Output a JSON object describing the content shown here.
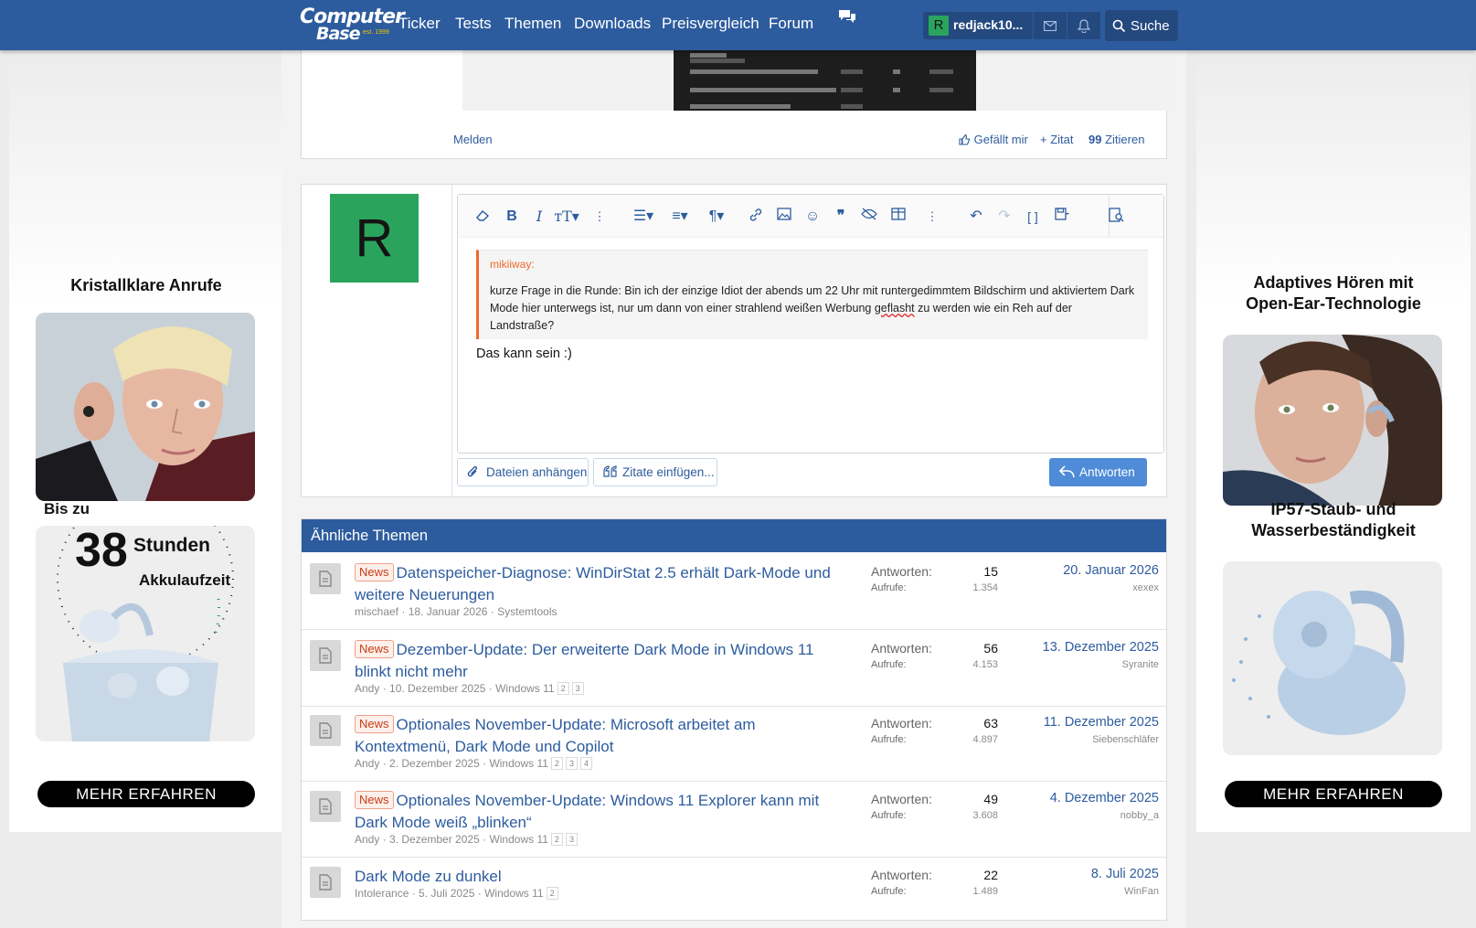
{
  "brand": {
    "line1": "Computer",
    "line2": "Base",
    "est": "est. 1999"
  },
  "nav": [
    "Ticker",
    "Tests",
    "Themen",
    "Downloads",
    "Preisvergleich",
    "Forum"
  ],
  "user": {
    "initial": "R",
    "name": "redjack10...",
    "avatar_color": "#2aa45d"
  },
  "search_label": "Suche",
  "colors": {
    "brand_blue": "#2d5c9e",
    "accent_orange": "#f06a2a",
    "primary_button": "#4f8bd7"
  },
  "ad_left": {
    "title": "Kristallklare Anrufe",
    "promo_prefix": "Bis zu",
    "promo_number": "38",
    "promo_unit": "Stunden",
    "promo_suffix": "Akkulaufzeit",
    "button": "MEHR ERFAHREN"
  },
  "ad_right": {
    "title_line1": "Adaptives Hören mit",
    "title_line2": "Open-Ear-Technologie",
    "subtitle_line1": "IP57-Staub- und",
    "subtitle_line2": "Wasserbeständigkeit",
    "button": "MEHR ERFAHREN"
  },
  "previous_post": {
    "report": "Melden",
    "like": "Gefällt mir",
    "quote_plus": "+ Zitat",
    "quote": "Zitieren"
  },
  "reply": {
    "avatar_initial": "R",
    "toolbar_icons": [
      "eraser-icon",
      "bold-icon",
      "italic-icon",
      "font-size-icon",
      "more-vertical-icon",
      "list-icon",
      "align-icon",
      "paragraph-icon",
      "more-vertical-icon",
      "link-icon",
      "image-icon",
      "smiley-icon",
      "quote-icon",
      "spoiler-icon",
      "table-icon",
      "more-vertical-icon",
      "undo-icon",
      "redo-icon",
      "bbcode-icon",
      "drafts-icon",
      "preview-icon"
    ],
    "quote": {
      "author": "mikiiway:",
      "text_before": "kurze Frage in die Runde: Bin ich der einzige Idiot der abends um 22 Uhr mit runtergedimmtem Bildschirm und aktiviertem Dark Mode hier unterwegs ist, nur um dann von einer strahlend weißen Werbung ",
      "text_misspelled": "geflasht",
      "text_after": " zu werden wie ein Reh auf der Landstraße?"
    },
    "body": "Das kann sein :)",
    "attach_label": "Dateien anhängen",
    "insert_quotes_label": "Zitate einfügen...",
    "submit_label": "Antworten"
  },
  "similar": {
    "heading": "Ähnliche Themen",
    "replies_label": "Antworten:",
    "views_label": "Aufrufe:",
    "threads": [
      {
        "badge": "News",
        "title": "Datenspeicher-Diagnose: WinDirStat 2.5 erhält Dark-Mode und weitere Neuerungen",
        "author": "mischaef",
        "date": "18. Januar 2026",
        "forum": "Systemtools",
        "pages": [],
        "replies": "15",
        "views": "1.354",
        "last_date": "20. Januar 2026",
        "last_user": "xexex"
      },
      {
        "badge": "News",
        "title": "Dezember-Update: Der erweiterte Dark Mode in Windows 11 blinkt nicht mehr",
        "author": "Andy",
        "date": "10. Dezember 2025",
        "forum": "Windows 11",
        "pages": [
          "2",
          "3"
        ],
        "replies": "56",
        "views": "4.153",
        "last_date": "13. Dezember 2025",
        "last_user": "Syranite"
      },
      {
        "badge": "News",
        "title": "Optionales November-Update: Microsoft arbeitet am Kontextmenü, Dark Mode und Copilot",
        "author": "Andy",
        "date": "2. Dezember 2025",
        "forum": "Windows 11",
        "pages": [
          "2",
          "3",
          "4"
        ],
        "replies": "63",
        "views": "4.897",
        "last_date": "11. Dezember 2025",
        "last_user": "Siebenschläfer"
      },
      {
        "badge": "News",
        "title": "Optionales November-Update: Windows 11 Explorer kann mit Dark Mode weiß „blinken“",
        "author": "Andy",
        "date": "3. Dezember 2025",
        "forum": "Windows 11",
        "pages": [
          "2",
          "3"
        ],
        "replies": "49",
        "views": "3.608",
        "last_date": "4. Dezember 2025",
        "last_user": "nobby_a"
      },
      {
        "badge": "",
        "title": "Dark Mode zu dunkel",
        "author": "Intolerance",
        "date": "5. Juli 2025",
        "forum": "Windows 11",
        "pages": [
          "2"
        ],
        "replies": "22",
        "views": "1.489",
        "last_date": "8. Juli 2025",
        "last_user": "WinFan"
      }
    ]
  }
}
